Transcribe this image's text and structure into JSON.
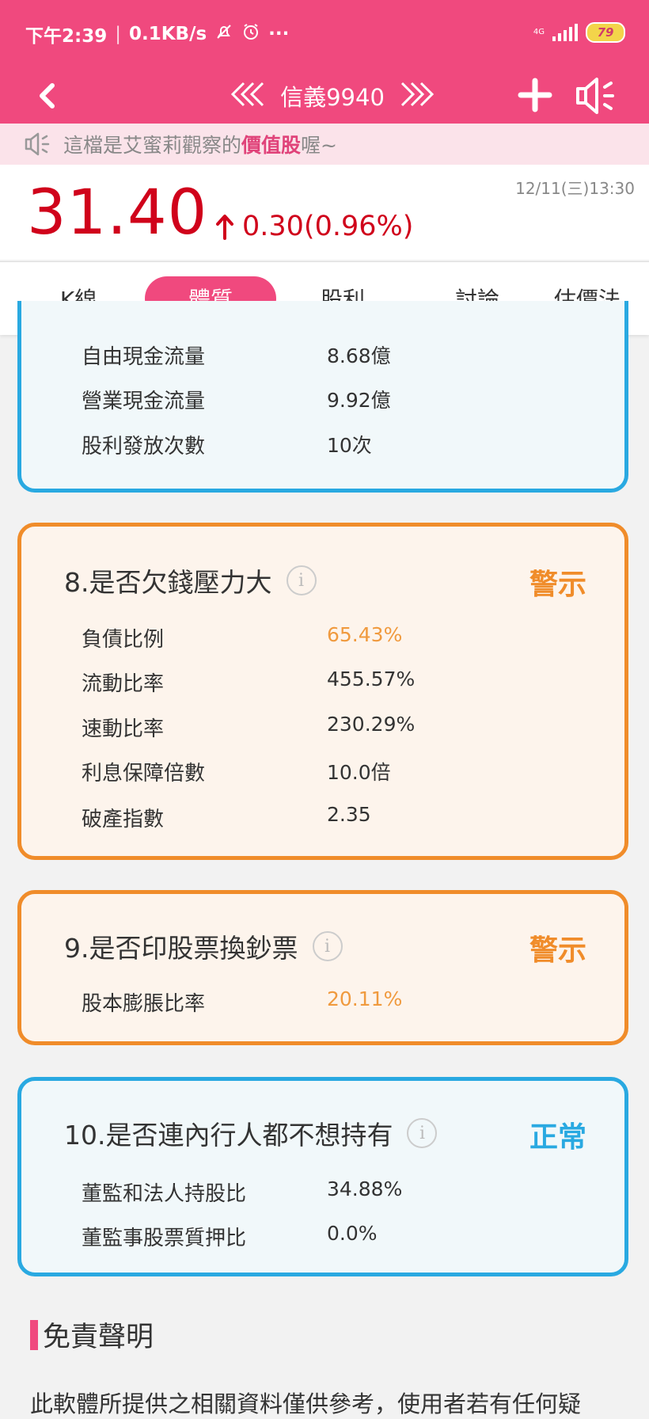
{
  "status_bar": {
    "time": "下午2:39",
    "net_speed": "0.1KB/s",
    "more": "···",
    "network": "4G",
    "battery": "79"
  },
  "nav": {
    "title": "信義9940"
  },
  "notice": {
    "prefix": "這檔是艾蜜莉觀察的",
    "highlight": "價值股",
    "suffix": "喔~"
  },
  "quote": {
    "price": "31.40",
    "change": "0.30(0.96%)",
    "timestamp": "12/11(三)13:30"
  },
  "tabs": [
    "K線",
    "體質",
    "股利",
    "討論",
    "估價法"
  ],
  "cards": {
    "cashflow": {
      "rows": [
        {
          "label": "自由現金流量",
          "value": "8.68億"
        },
        {
          "label": "營業現金流量",
          "value": "9.92億"
        },
        {
          "label": "股利發放次數",
          "value": "10次"
        }
      ]
    },
    "debt": {
      "title": "8.是否欠錢壓力大",
      "status": "警示",
      "rows": [
        {
          "label": "負債比例",
          "value": "65.43%"
        },
        {
          "label": "流動比率",
          "value": "455.57%"
        },
        {
          "label": "速動比率",
          "value": "230.29%"
        },
        {
          "label": "利息保障倍數",
          "value": "10.0倍"
        },
        {
          "label": "破產指數",
          "value": "2.35"
        }
      ]
    },
    "dilution": {
      "title": "9.是否印股票換鈔票",
      "status": "警示",
      "rows": [
        {
          "label": "股本膨脹比率",
          "value": "20.11%"
        }
      ]
    },
    "insider": {
      "title": "10.是否連內行人都不想持有",
      "status": "正常",
      "rows": [
        {
          "label": "董監和法人持股比",
          "value": "34.88%"
        },
        {
          "label": "董監事股票質押比",
          "value": "0.0%"
        }
      ]
    }
  },
  "info_glyph": "i",
  "disclaimer": {
    "title": "免責聲明",
    "text": "此軟體所提供之相關資料僅供參考，使用者若有任何疑"
  },
  "colors": {
    "brand": "#f0497e",
    "warn": "#f08c2a",
    "ok": "#29a9e1",
    "up": "#d0021b"
  }
}
